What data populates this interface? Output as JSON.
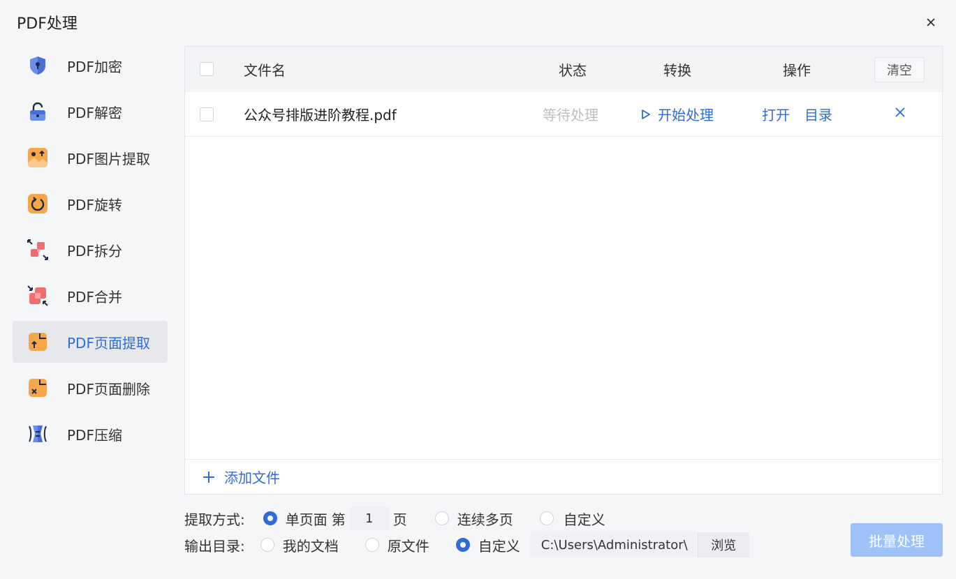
{
  "window": {
    "title": "PDF处理"
  },
  "sidebar": {
    "items": [
      {
        "label": "PDF加密",
        "icon": "shield-lock-icon",
        "active": false
      },
      {
        "label": "PDF解密",
        "icon": "padlock-icon",
        "active": false
      },
      {
        "label": "PDF图片提取",
        "icon": "image-extract-icon",
        "active": false
      },
      {
        "label": "PDF旋转",
        "icon": "rotate-icon",
        "active": false
      },
      {
        "label": "PDF拆分",
        "icon": "split-icon",
        "active": false
      },
      {
        "label": "PDF合并",
        "icon": "merge-icon",
        "active": false
      },
      {
        "label": "PDF页面提取",
        "icon": "page-extract-icon",
        "active": true
      },
      {
        "label": "PDF页面删除",
        "icon": "page-delete-icon",
        "active": false
      },
      {
        "label": "PDF压缩",
        "icon": "compress-icon",
        "active": false
      }
    ]
  },
  "table": {
    "headers": {
      "filename": "文件名",
      "status": "状态",
      "convert": "转换",
      "actions": "操作"
    },
    "clear_label": "清空",
    "rows": [
      {
        "filename": "公众号排版进阶教程.pdf",
        "status": "等待处理",
        "start": "开始处理",
        "open": "打开",
        "dir": "目录"
      }
    ],
    "add_label": "添加文件"
  },
  "options": {
    "extract_label": "提取方式:",
    "single_page": "单页面",
    "page_prefix": "第",
    "page_value": "1",
    "page_suffix": "页",
    "multi_page": "连续多页",
    "custom_extract": "自定义",
    "output_label": "输出目录:",
    "my_docs": "我的文档",
    "original": "原文件",
    "custom_output": "自定义",
    "path": "C:\\Users\\Administrator\\",
    "browse": "浏览"
  },
  "batch_label": "批量处理",
  "colors": {
    "accent": "#2f6bd9",
    "batch_disabled": "#9dc1f8"
  }
}
